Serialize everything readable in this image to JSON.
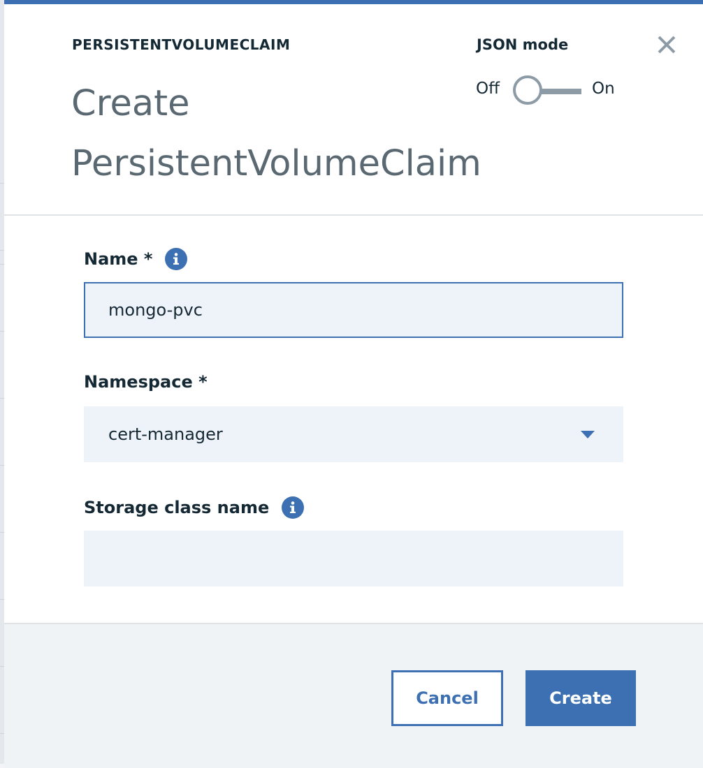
{
  "modal": {
    "type_label": "PERSISTENTVOLUMECLAIM",
    "title": "Create PersistentVolumeClaim",
    "json_mode": {
      "label": "JSON mode",
      "off_label": "Off",
      "on_label": "On",
      "state": "off"
    }
  },
  "form": {
    "name": {
      "label": "Name *",
      "value": "mongo-pvc"
    },
    "namespace": {
      "label": "Namespace *",
      "selected": "cert-manager"
    },
    "storage_class": {
      "label": "Storage class name",
      "value": ""
    }
  },
  "footer": {
    "cancel_label": "Cancel",
    "create_label": "Create"
  },
  "colors": {
    "primary": "#3d70b2",
    "text": "#152935",
    "muted_text": "#5a6872",
    "input_bg": "#eef2f9",
    "footer_bg": "#f0f3f6"
  },
  "icons": {
    "close": "close-icon",
    "info": "info-icon",
    "dropdown": "chevron-down-icon"
  }
}
